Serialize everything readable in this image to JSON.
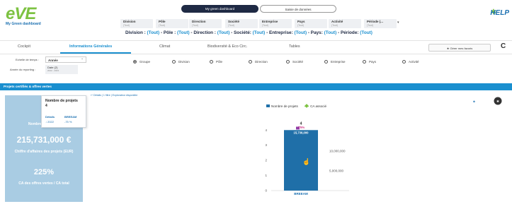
{
  "logo": {
    "name": "eVE",
    "subtitle": "My Green dashboard"
  },
  "top_toggle": {
    "active": "My green dashboard",
    "inactive": "Saisie de données"
  },
  "help": {
    "label": "HELP"
  },
  "filters": [
    {
      "label": "Division",
      "value": "(Tout)"
    },
    {
      "label": "Pôle",
      "value": "(Tout)"
    },
    {
      "label": "Direction",
      "value": "(Tout)"
    },
    {
      "label": "Société",
      "value": "(Tout)"
    },
    {
      "label": "Entreprise",
      "value": "(Tout)"
    },
    {
      "label": "Pays",
      "value": "(Tout)"
    },
    {
      "label": "Activité",
      "value": "(Tout)"
    },
    {
      "label": "Période (...",
      "value": "(Tout)"
    }
  ],
  "filter_more": "▾",
  "summary": {
    "parts": [
      {
        "k": "Division : ",
        "v": "(Tout)"
      },
      {
        "k": " - Pôle : ",
        "v": "(Tout)"
      },
      {
        "k": " - Direction : ",
        "v": "(Tout)"
      },
      {
        "k": " - Société: ",
        "v": "(Tout)"
      },
      {
        "k": " - Entreprise: ",
        "v": "(Tout)"
      },
      {
        "k": " - Pays: ",
        "v": "(Tout)"
      },
      {
        "k": " - Période: ",
        "v": "(Tout)"
      }
    ]
  },
  "tabs": [
    {
      "label": "Cockpit",
      "active": false
    },
    {
      "label": "Informations Générales",
      "active": true
    },
    {
      "label": "Climat",
      "active": false
    },
    {
      "label": "Biodiversité & Eco Circ.",
      "active": false
    },
    {
      "label": "Tables",
      "active": false
    }
  ],
  "favorites_button": "Gérer mes favoris",
  "refresh_icon": "C",
  "time_scale": {
    "label": "Echelle de temps :",
    "value": "Année"
  },
  "reporting_year": {
    "label": "Année du reporting :",
    "value": "Date (2)",
    "range": "2022 - 2023"
  },
  "group_by": {
    "options": [
      "Groupe",
      "Division",
      "Pôle",
      "Direction",
      "Société",
      "Entreprise",
      "Pays",
      "Activité"
    ],
    "selected": "Groupe"
  },
  "section": {
    "title": "Projets certifiés & offres vertes",
    "subline": "Détails | 1 filtre | Explorateur disponible",
    "subline_left": "Détails",
    "subline_mid": "| 1 filtre |"
  },
  "kpi": {
    "projects_count": "4",
    "projects_label": "Nombre de projets",
    "revenue_value": "215,731,000 €",
    "revenue_label": "Chiffre d'affaires des projets (EUR)",
    "ratio_value": "225%",
    "ratio_label": "CA des offres vertes / CA total"
  },
  "tooltip": {
    "title": "Nombre de projets",
    "value": "4",
    "col1_header": "Détails",
    "col2_header": "BREEAM",
    "col1_value": "↓ 2022",
    "col2_value": "-75 %"
  },
  "chart_data": {
    "type": "bar",
    "legend": [
      {
        "name": "Nombre de projets",
        "color": "#1f6fa8",
        "kind": "bar"
      },
      {
        "name": "CA associé",
        "color": "#7dc242",
        "kind": "line"
      }
    ],
    "categories": [
      "BREEAM"
    ],
    "series": [
      {
        "name": "Nombre de projets",
        "values": [
          4
        ],
        "axis": "left"
      },
      {
        "name": "CA associé",
        "values": [
          15736000
        ],
        "axis": "right"
      }
    ],
    "bar_label": "4",
    "bar_change": "-75%",
    "ca_label": "15,736,000",
    "y_left_ticks": [
      "0",
      "1",
      "2",
      "3",
      "4"
    ],
    "y_left_lim": [
      0,
      4.2
    ],
    "y_right_ticks": [
      "5,000,000",
      "10,000,000"
    ],
    "y_right_lim": [
      0,
      16000000
    ]
  }
}
